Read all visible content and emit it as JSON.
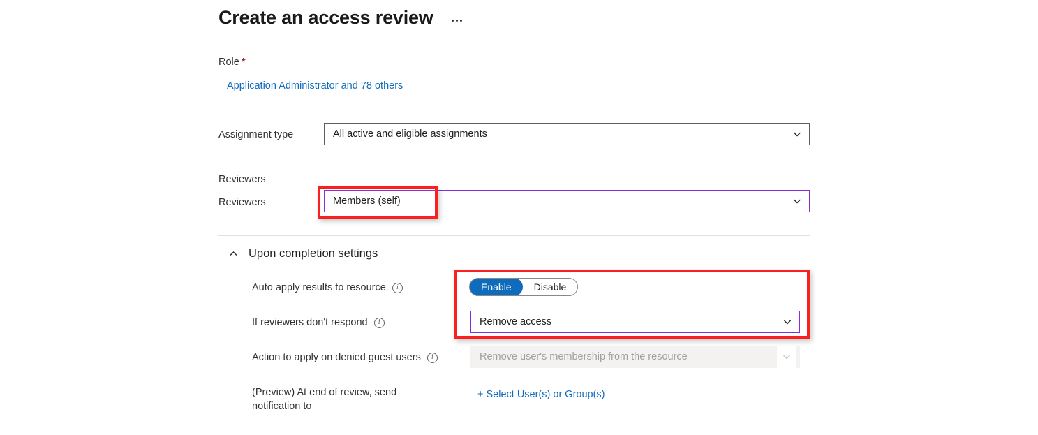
{
  "header": {
    "title": "Create an access review",
    "more_menu_label": "More options"
  },
  "form": {
    "role": {
      "label": "Role",
      "required_marker": "*",
      "value_link": "Application Administrator and 78 others"
    },
    "assignment_type": {
      "label": "Assignment type",
      "value": "All active and eligible assignments"
    },
    "reviewers_section_header": "Reviewers",
    "reviewers": {
      "label": "Reviewers",
      "value": "Members (self)"
    }
  },
  "upon_completion": {
    "section_title": "Upon completion settings",
    "auto_apply": {
      "label": "Auto apply results to resource",
      "options": [
        "Enable",
        "Disable"
      ],
      "selected": "Enable"
    },
    "no_response": {
      "label": "If reviewers don't respond",
      "value": "Remove access"
    },
    "denied_guest_users": {
      "label": "Action to apply on denied guest users",
      "value": "Remove user's membership from the resource",
      "disabled": true
    },
    "notification": {
      "label_line1": "(Preview) At end of review, send",
      "label_line2": "notification to",
      "action_link": "+ Select User(s) or Group(s)"
    }
  },
  "annotations": {
    "highlight_reviewers": "reviewers-dropdown-highlight",
    "highlight_completion": "upon-completion-controls-highlight"
  },
  "colors": {
    "link": "#0f6cbd",
    "accent_selected": "#0f6cbd",
    "focus_border": "#8a2be2",
    "annotation": "#fb2020",
    "required": "#a4262c"
  }
}
